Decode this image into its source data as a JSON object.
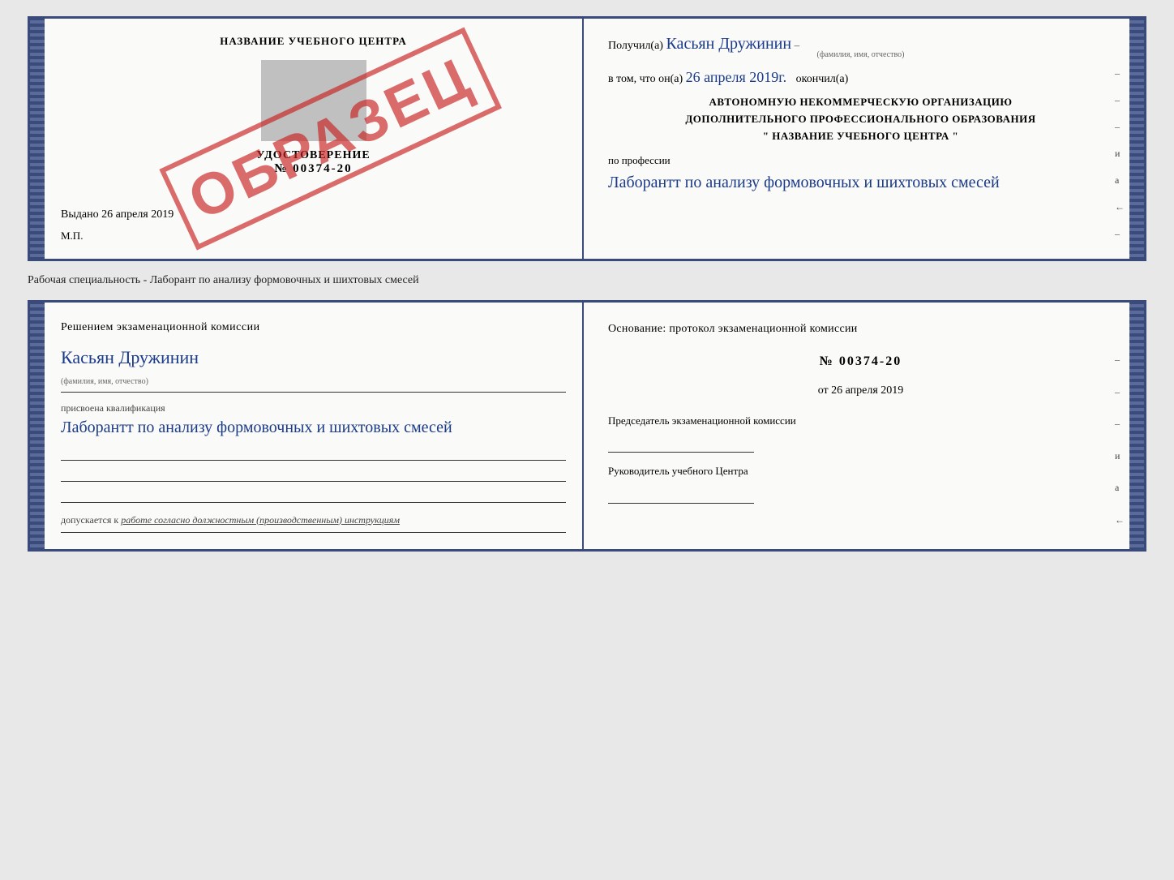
{
  "top_doc": {
    "left": {
      "title": "НАЗВАНИЕ УЧЕБНОГО ЦЕНТРА",
      "stamp": "ОБРАЗЕЦ",
      "udostoverenie": "УДОСТОВЕРЕНИЕ",
      "number": "№ 00374-20",
      "vydano_label": "Выдано",
      "vydano_date": "26 апреля 2019",
      "mp": "М.П."
    },
    "right": {
      "poluchil_label": "Получил(а)",
      "poluchil_name": "Касьян Дружинин",
      "fio_hint": "(фамилия, имя, отчество)",
      "vtom_label": "в том, что он(а)",
      "vtom_date": "26 апреля 2019г.",
      "okonchil": "окончил(а)",
      "org_line1": "АВТОНОМНУЮ НЕКОММЕРЧЕСКУЮ ОРГАНИЗАЦИЮ",
      "org_line2": "ДОПОЛНИТЕЛЬНОГО ПРОФЕССИОНАЛЬНОГО ОБРАЗОВАНИЯ",
      "org_line3": "\"  НАЗВАНИЕ УЧЕБНОГО ЦЕНТРА  \"",
      "prof_label": "по профессии",
      "prof_value": "Лаборантт по анализу формовочных и шихтовых смесей",
      "side_marks": [
        "–",
        "–",
        "–",
        "и",
        "а",
        "←",
        "–",
        "–",
        "–"
      ]
    }
  },
  "separator": {
    "text": "Рабочая специальность - Лаборант по анализу формовочных и шихтовых смесей"
  },
  "bottom_doc": {
    "left": {
      "title": "Решением экзаменационной комиссии",
      "name": "Касьян Дружинин",
      "fio_hint": "(фамилия, имя, отчество)",
      "prisvoena_label": "присвоена квалификация",
      "prisvoena_value": "Лаборантт по анализу формовочных и шихтовых смесей",
      "dopusk_label": "допускается к",
      "dopusk_value": "работе согласно должностным (производственным) инструкциям"
    },
    "right": {
      "osnov_label": "Основание: протокол экзаменационной комиссии",
      "protocol_number": "№ 00374-20",
      "ot_label": "от",
      "ot_date": "26 апреля 2019",
      "predsedatel_label": "Председатель экзаменационной комиссии",
      "rukov_label": "Руководитель учебного Центра",
      "side_marks": [
        "–",
        "–",
        "–",
        "и",
        "а",
        "←",
        "–",
        "–",
        "–"
      ]
    }
  }
}
